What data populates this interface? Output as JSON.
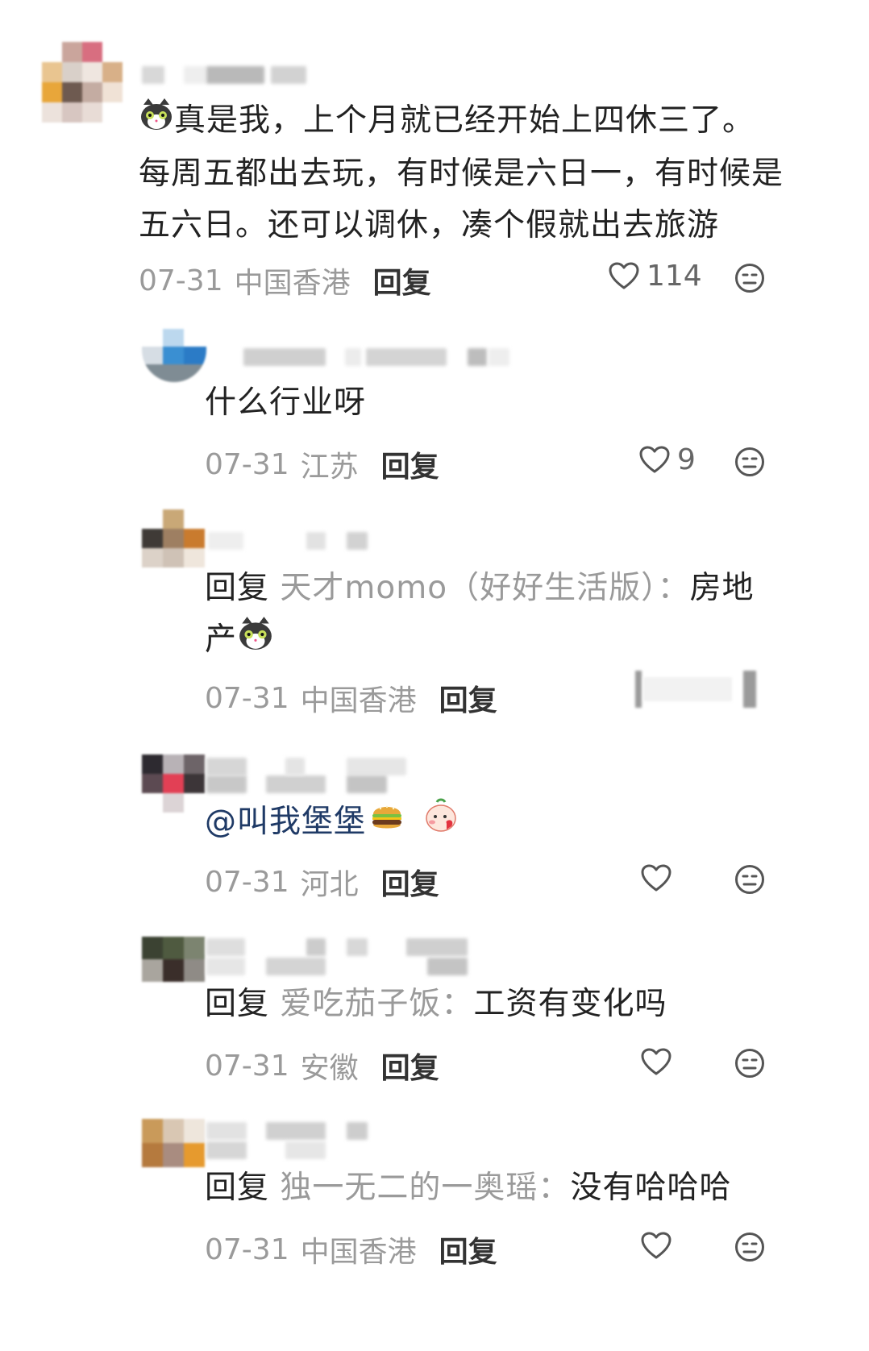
{
  "comments": [
    {
      "text_pre": "",
      "text": "真是我，上个月就已经开始上四休三了。每周五都出去玩，有时候是六日一，有时候是五六日。还可以调休，凑个假就出去旅游",
      "date": "07-31",
      "location": "中国香港",
      "reply_label": "回复",
      "likes": "114",
      "icon_prefix": "cat-emoji"
    },
    {
      "text": "什么行业呀",
      "date": "07-31",
      "location": "江苏",
      "reply_label": "回复",
      "likes": "9"
    },
    {
      "reply_prefix": "回复",
      "reply_target": "天才momo（好好生活版）：",
      "text": "房地产",
      "date": "07-31",
      "location": "中国香港",
      "reply_label": "回复"
    },
    {
      "mention": "@叫我堡堡",
      "date": "07-31",
      "location": "河北",
      "reply_label": "回复"
    },
    {
      "reply_prefix": "回复",
      "reply_target": "爱吃茄子饭：",
      "text": "工资有变化吗",
      "date": "07-31",
      "location": "安徽",
      "reply_label": "回复"
    },
    {
      "reply_prefix": "回复",
      "reply_target": "独一无二的一奥瑶：",
      "text": "没有哈哈哈",
      "date": "07-31",
      "location": "中国香港",
      "reply_label": "回复"
    }
  ],
  "colors": {
    "text": "#222222",
    "meta": "#9a9a9a",
    "mention": "#1f3a66",
    "icon": "#555555"
  },
  "icons": [
    "heart-icon",
    "dislike-face-icon",
    "cat-emoji",
    "burger-emoji",
    "blushing-emoji"
  ]
}
